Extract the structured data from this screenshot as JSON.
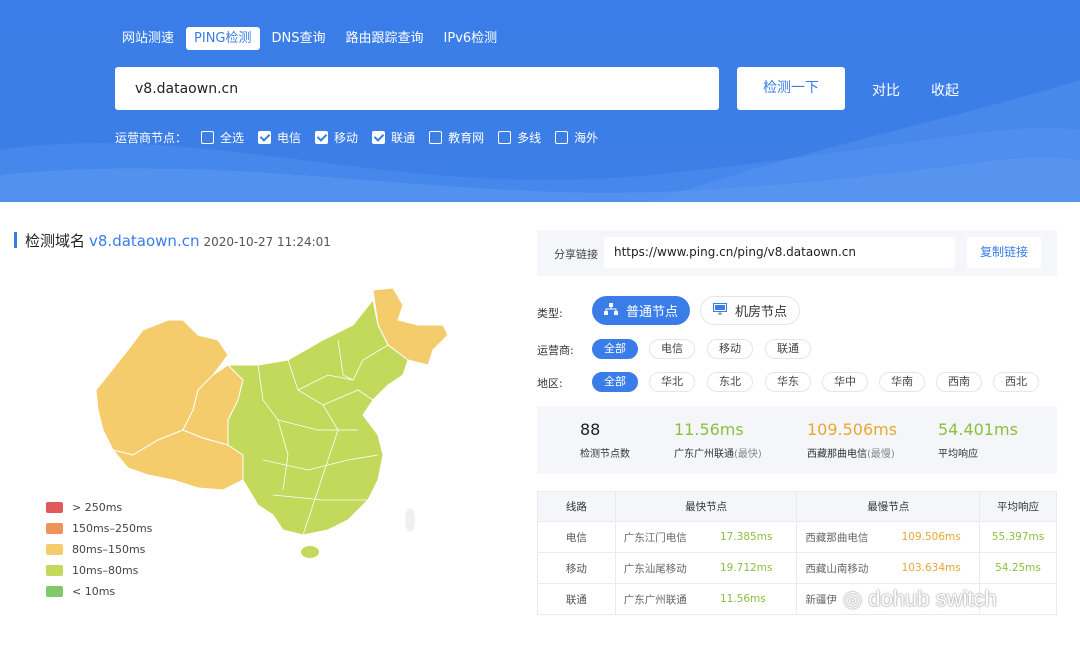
{
  "tabs": [
    "网站测速",
    "PING检测",
    "DNS查询",
    "路由跟踪查询",
    "IPv6检测"
  ],
  "search": {
    "value": "v8.dataown.cn"
  },
  "buttons": {
    "check": "检测一下",
    "compare": "对比",
    "collapse": "收起"
  },
  "isp_filter": {
    "label": "运营商节点：",
    "options": [
      {
        "label": "全选",
        "checked": false
      },
      {
        "label": "电信",
        "checked": true
      },
      {
        "label": "移动",
        "checked": true
      },
      {
        "label": "联通",
        "checked": true
      },
      {
        "label": "教育网",
        "checked": false
      },
      {
        "label": "多线",
        "checked": false
      },
      {
        "label": "海外",
        "checked": false
      }
    ]
  },
  "result": {
    "label": "检测域名",
    "domain": "v8.dataown.cn",
    "time": "2020-10-27 11:24:01"
  },
  "legend": [
    {
      "label": "> 250ms",
      "color": "#e05a5a"
    },
    {
      "label": "150ms–250ms",
      "color": "#f0935a"
    },
    {
      "label": "80ms–150ms",
      "color": "#f4cc6c"
    },
    {
      "label": "10ms–80ms",
      "color": "#c3d95c"
    },
    {
      "label": "< 10ms",
      "color": "#7fc96a"
    }
  ],
  "share": {
    "label": "分享链接",
    "url": "https://www.ping.cn/ping/v8.dataown.cn",
    "copy": "复制链接"
  },
  "type": {
    "label": "类型:",
    "options": [
      "普通节点",
      "机房节点"
    ]
  },
  "carrier": {
    "label": "运营商:",
    "options": [
      "全部",
      "电信",
      "移动",
      "联通"
    ]
  },
  "region": {
    "label": "地区:",
    "options": [
      "全部",
      "华北",
      "东北",
      "华东",
      "华中",
      "华南",
      "西南",
      "西北"
    ]
  },
  "stats": {
    "count": {
      "value": "88",
      "label": "检测节点数"
    },
    "fastest": {
      "value": "11.56ms",
      "label": "广东广州联通",
      "sub": "(最快)"
    },
    "slowest": {
      "value": "109.506ms",
      "label": "西藏那曲电信",
      "sub": "(最慢)"
    },
    "average": {
      "value": "54.401ms",
      "label": "平均响应"
    }
  },
  "table": {
    "headers": [
      "线路",
      "最快节点",
      "最慢节点",
      "平均响应"
    ],
    "rows": [
      {
        "line": "电信",
        "fast_node": "广东江门电信",
        "fast_ms": "17.385ms",
        "slow_node": "西藏那曲电信",
        "slow_ms": "109.506ms",
        "avg": "55.397ms"
      },
      {
        "line": "移动",
        "fast_node": "广东汕尾移动",
        "fast_ms": "19.712ms",
        "slow_node": "西藏山南移动",
        "slow_ms": "103.634ms",
        "avg": "54.25ms"
      },
      {
        "line": "联通",
        "fast_node": "广东广州联通",
        "fast_ms": "11.56ms",
        "slow_node": "新疆伊",
        "slow_ms": "",
        "avg": ""
      }
    ]
  },
  "watermark": "dohub switch"
}
